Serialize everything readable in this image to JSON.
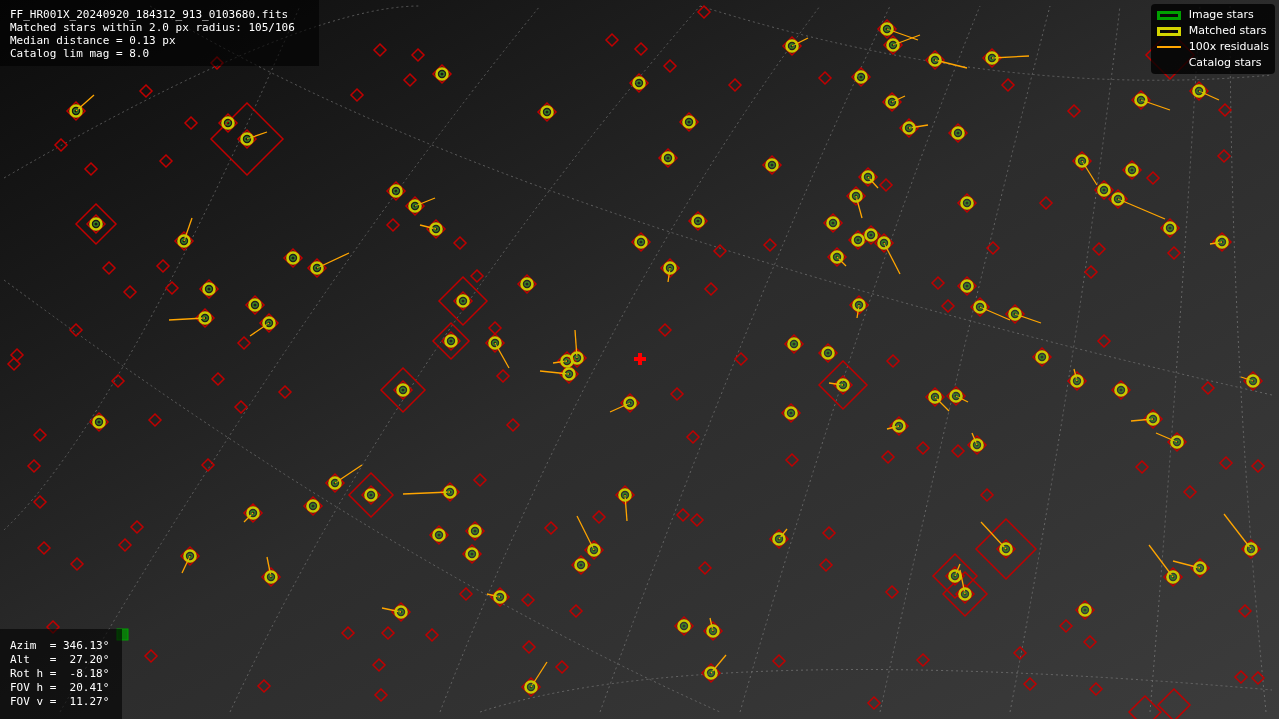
{
  "info_lines": [
    "FF_HR001X_20240920_184312_913_0103680.fits",
    "Matched stars within 2.0 px radius: 105/106",
    "Median distance = 0.13 px",
    "Catalog lim mag = 8.0"
  ],
  "legend": [
    {
      "kind": "box",
      "color": "#00a000",
      "label": "Image stars"
    },
    {
      "kind": "box",
      "color": "#d4d400",
      "label": "Matched stars"
    },
    {
      "kind": "line",
      "color": "#ffa500",
      "label": "100x residuals"
    },
    {
      "kind": "none",
      "label": "Catalog stars"
    }
  ],
  "pointing_lines": [
    "Azim  = 346.13°",
    "Alt   =  27.20°",
    "Rot h =  -8.18°",
    "FOV h =  20.41°",
    "FOV v =  11.27°"
  ]
}
